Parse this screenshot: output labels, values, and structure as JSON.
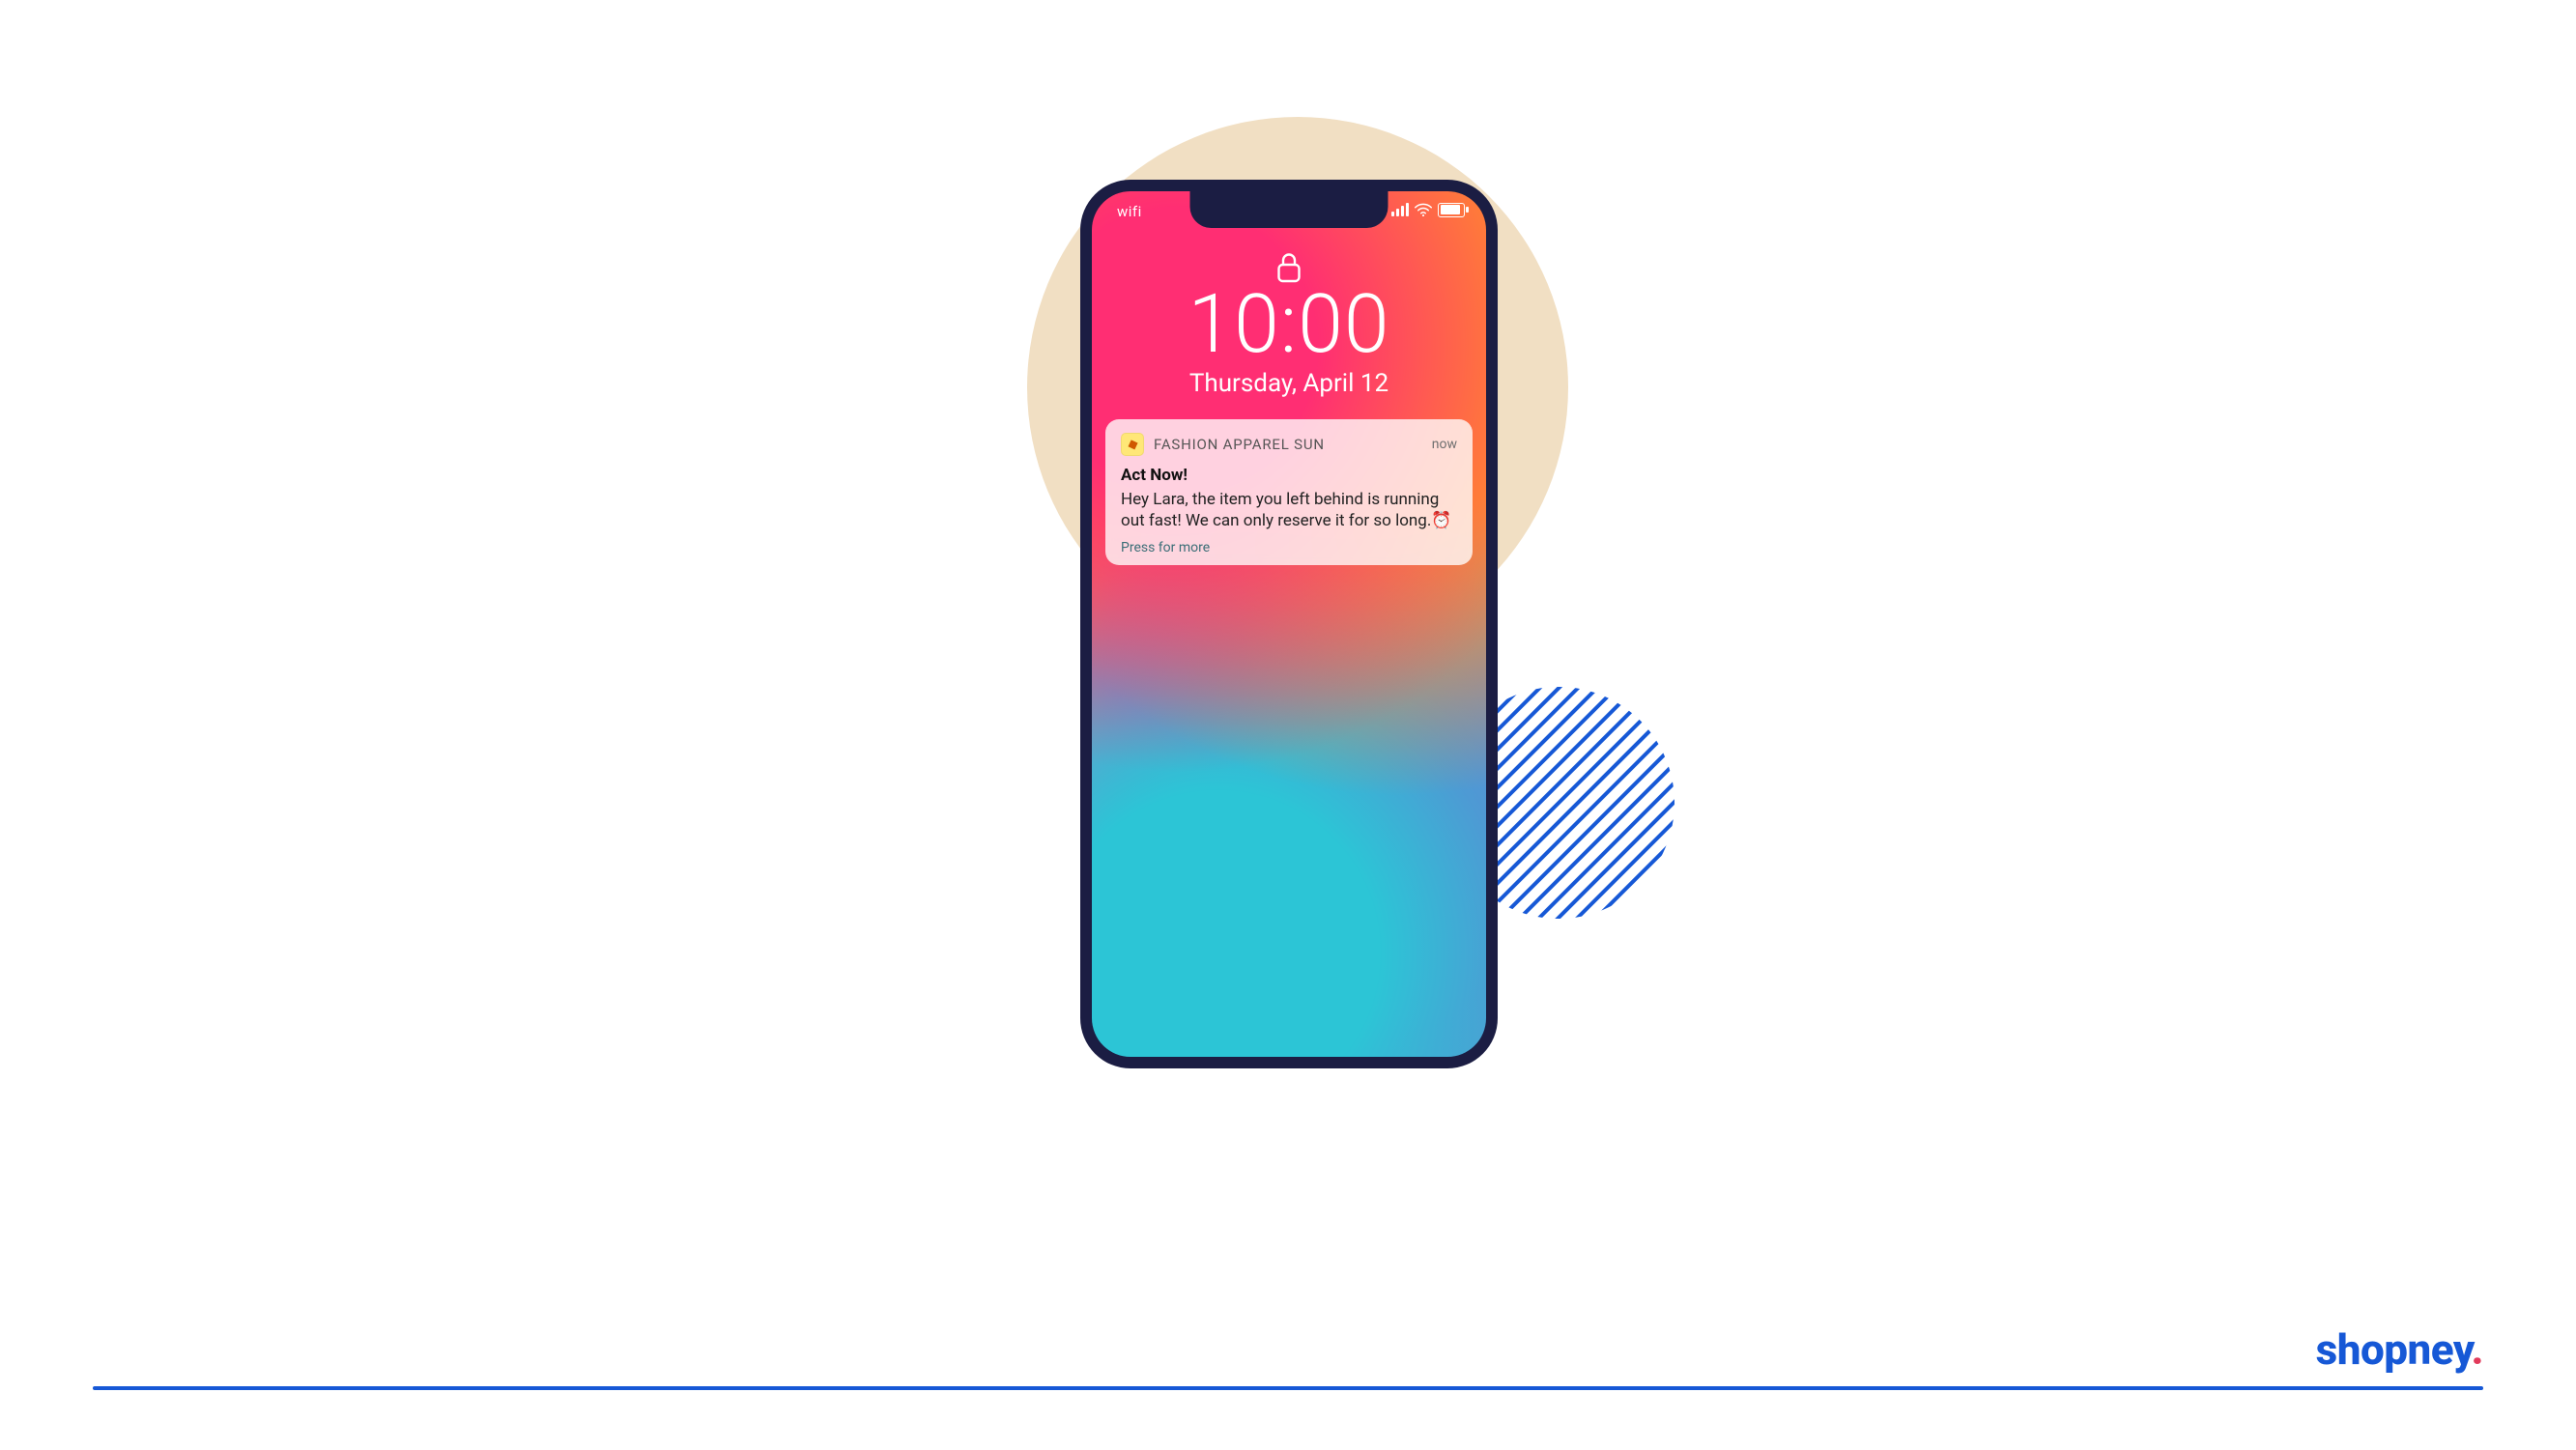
{
  "status_bar": {
    "left_label": "wifi",
    "icons": {
      "signal": "signal-icon",
      "wifi": "wifi-icon",
      "battery": "battery-icon"
    }
  },
  "lockscreen": {
    "lock_icon": "lock-icon",
    "time": "10:00",
    "date": "Thursday, April 12"
  },
  "notification": {
    "app_name": "FASHION APPAREL SUN",
    "time_label": "now",
    "title": "Act Now!",
    "body": "Hey Lara, the item you left behind is running out fast! We can only reserve it for so long.",
    "body_emoji": "⏰",
    "press_more": "Press for more",
    "app_icon": "price-tag-icon"
  },
  "brand": {
    "name": "shopney",
    "suffix": "."
  },
  "colors": {
    "brand_blue": "#1658d6",
    "brand_dot": "#e23a5b",
    "beige": "#f1dfc3"
  }
}
